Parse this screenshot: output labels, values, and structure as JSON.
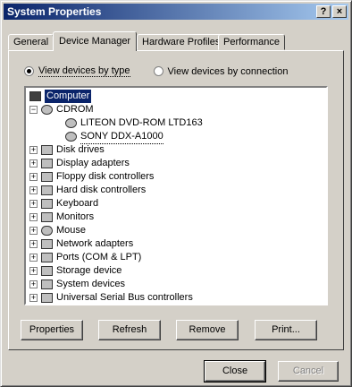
{
  "window": {
    "title": "System Properties"
  },
  "title_buttons": {
    "help": "?",
    "close": "×"
  },
  "tabs": [
    {
      "label": "General"
    },
    {
      "label": "Device Manager"
    },
    {
      "label": "Hardware Profiles"
    },
    {
      "label": "Performance"
    }
  ],
  "view": {
    "by_type": "View devices by type",
    "by_connection": "View devices by connection",
    "selected": "by_type"
  },
  "tree": {
    "root": "Computer",
    "cdrom": "CDROM",
    "cdrom_children": [
      "LITEON DVD-ROM LTD163",
      "SONY DDX-A1000"
    ],
    "items": [
      {
        "label": "Disk drives",
        "icon": "disk-drive-icon"
      },
      {
        "label": "Display adapters",
        "icon": "display-adapter-icon"
      },
      {
        "label": "Floppy disk controllers",
        "icon": "floppy-controller-icon"
      },
      {
        "label": "Hard disk controllers",
        "icon": "hard-disk-controller-icon"
      },
      {
        "label": "Keyboard",
        "icon": "keyboard-icon"
      },
      {
        "label": "Monitors",
        "icon": "monitor-icon"
      },
      {
        "label": "Mouse",
        "icon": "mouse-icon"
      },
      {
        "label": "Network adapters",
        "icon": "network-adapter-icon"
      },
      {
        "label": "Ports (COM & LPT)",
        "icon": "port-icon"
      },
      {
        "label": "Storage device",
        "icon": "storage-device-icon"
      },
      {
        "label": "System devices",
        "icon": "system-device-icon"
      },
      {
        "label": "Universal Serial Bus controllers",
        "icon": "usb-icon"
      }
    ]
  },
  "buttons": {
    "properties": "Properties",
    "refresh": "Refresh",
    "remove": "Remove",
    "print": "Print...",
    "close": "Close",
    "cancel": "Cancel"
  },
  "colors": {
    "selection": "#0a246a",
    "face": "#d4d0c8"
  }
}
